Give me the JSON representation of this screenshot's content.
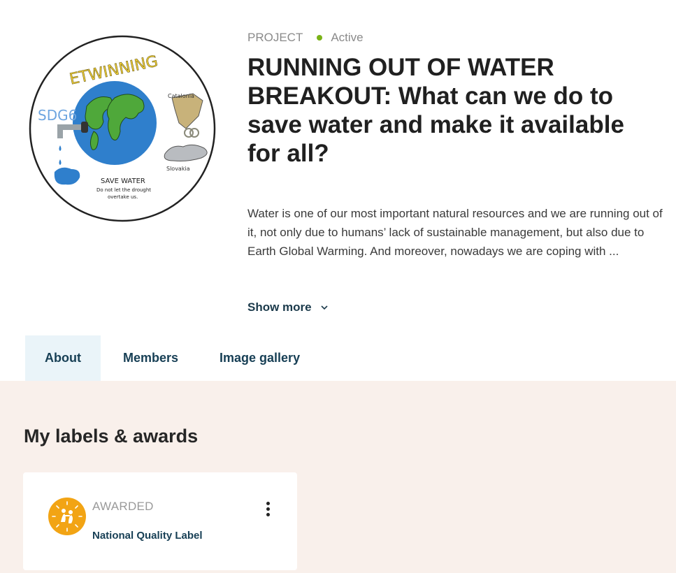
{
  "project": {
    "type_label": "PROJECT",
    "status": "Active",
    "status_color": "#7ab317",
    "title": "RUNNING OUT OF WATER BREAKOUT: What can we do to save water and make it available for all?",
    "description": "Water is one of our most important natural resources and we are running out of it, not only due to humans’ lack of sustainable management, but also due to Earth Global Warming. And moreover, nowadays we are coping with ...",
    "show_more_label": "Show more",
    "logo": {
      "top_text": "ETWINNING",
      "left_text": "SDG6",
      "region_1": "Catalonia",
      "region_2": "Slovakia",
      "slogan_1": "SAVE WATER",
      "slogan_2": "Do not let the drought",
      "slogan_3": "overtake us."
    }
  },
  "tabs": [
    {
      "label": "About",
      "active": true
    },
    {
      "label": "Members",
      "active": false
    },
    {
      "label": "Image gallery",
      "active": false
    }
  ],
  "labels_section": {
    "title": "My labels & awards",
    "background": "#f9f0eb",
    "cards": [
      {
        "status": "AWARDED",
        "name": "National Quality Label",
        "badge_color": "#f2a414"
      }
    ]
  }
}
